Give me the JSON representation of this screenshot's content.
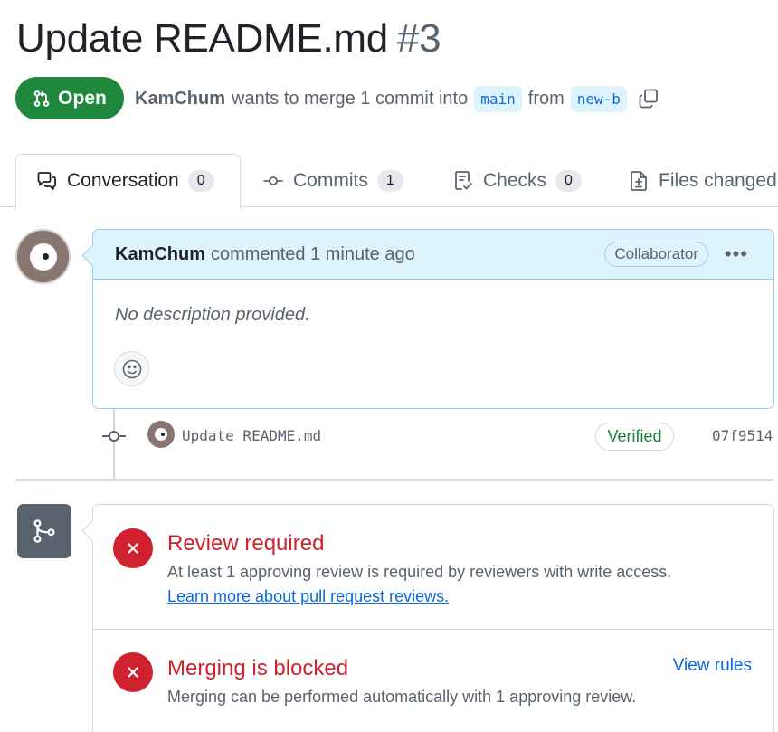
{
  "pr": {
    "title": "Update README.md",
    "number": "#3",
    "state": "Open",
    "author": "KamChum",
    "merge_text": "wants to merge 1 commit into",
    "base_branch": "main",
    "from_text": "from",
    "head_branch": "new-b"
  },
  "tabs": [
    {
      "label": "Conversation",
      "count": "0",
      "icon": "comment-discussion-icon"
    },
    {
      "label": "Commits",
      "count": "1",
      "icon": "git-commit-icon"
    },
    {
      "label": "Checks",
      "count": "0",
      "icon": "checklist-icon"
    },
    {
      "label": "Files changed",
      "icon": "file-diff-icon"
    }
  ],
  "comment": {
    "author": "KamChum",
    "action": "commented",
    "time": "1 minute ago",
    "role": "Collaborator",
    "menu": "•••",
    "body": "No description provided."
  },
  "commit": {
    "message": "Update README.md",
    "verified": "Verified",
    "sha": "07f9514"
  },
  "checks": [
    {
      "title": "Review required",
      "description": "At least 1 approving review is required by reviewers with write access.",
      "link": "Learn more about pull request reviews."
    },
    {
      "title": "Merging is blocked",
      "description": "Merging can be performed automatically with 1 approving review.",
      "action": "View rules"
    }
  ],
  "colors": {
    "open_green": "#1f883d",
    "danger_red": "#cf222e",
    "link_blue": "#0969da",
    "comment_header_bg": "#ddf4ff"
  }
}
